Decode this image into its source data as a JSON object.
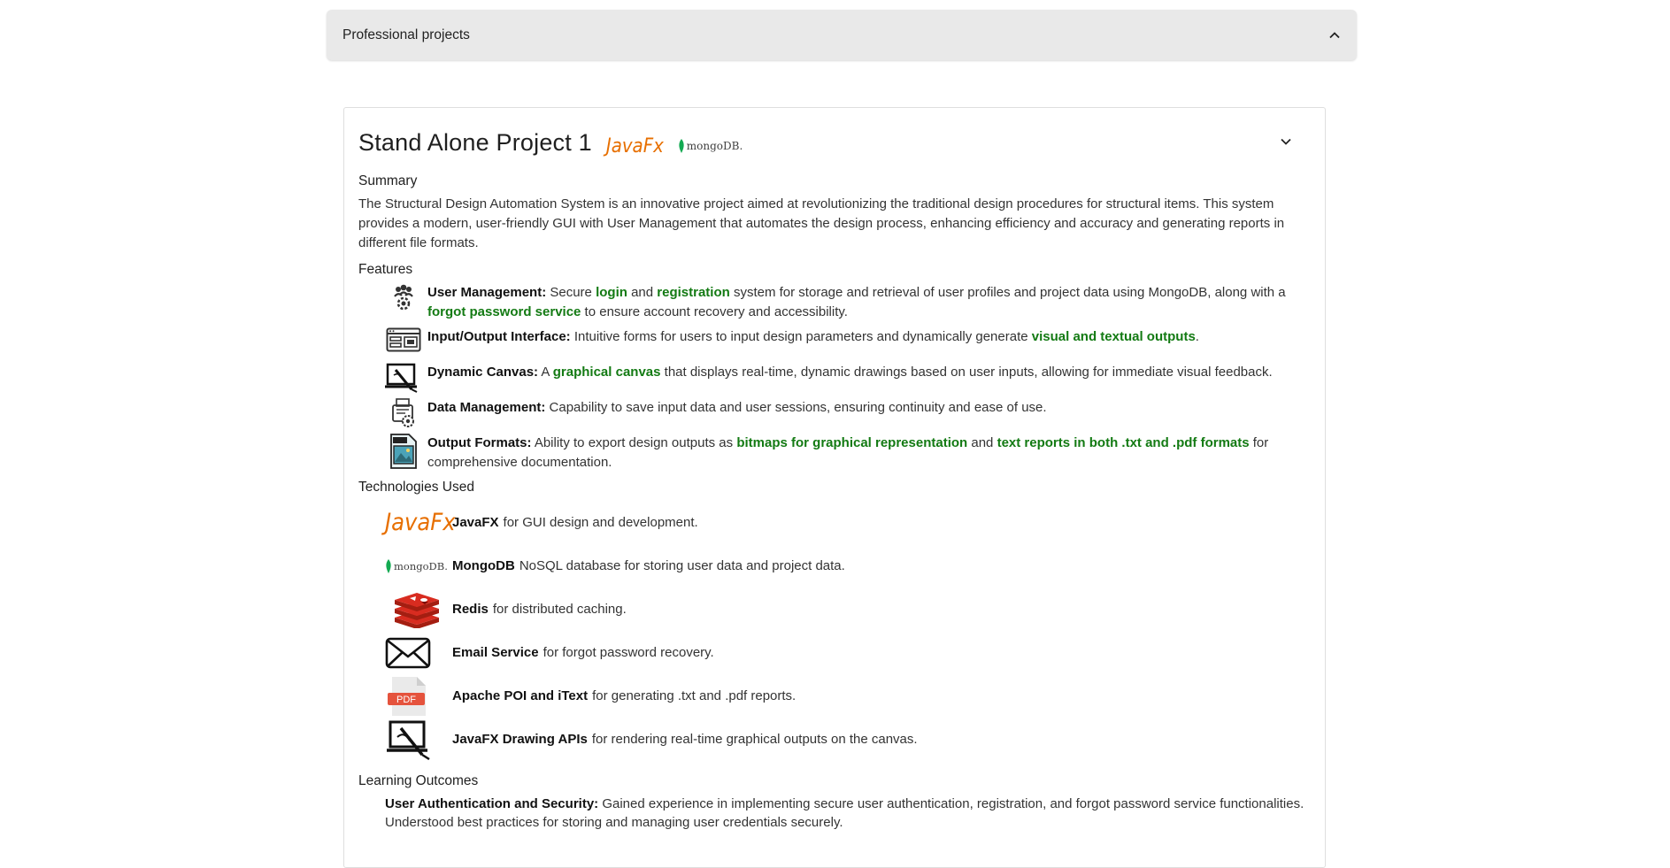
{
  "accordion": {
    "label": "Professional projects"
  },
  "project": {
    "title": "Stand Alone Project 1",
    "logos": {
      "javafx": "JavaFx",
      "mongodb": "mongoDB."
    },
    "summary_heading": "Summary",
    "summary_text": "The Structural Design Automation System is an innovative project aimed at revolutionizing the traditional design procedures for structural items. This system provides a modern, user-friendly GUI with User Management that automates the design process, enhancing efficiency and accuracy and generating reports in different file formats.",
    "features_heading": "Features",
    "features": [
      {
        "icon": "user-management-icon",
        "title": "User Management:",
        "t1": " Secure ",
        "h1": "login",
        "t2": " and ",
        "h2": "registration",
        "t3": " system for storage and retrieval of user profiles and project data using MongoDB, along with a ",
        "h3": "forgot password service",
        "t4": " to ensure account recovery and accessibility."
      },
      {
        "icon": "input-output-icon",
        "title": "Input/Output Interface:",
        "t1": " Intuitive forms for users to input design parameters and dynamically generate ",
        "h1": "visual and textual outputs",
        "t2": "."
      },
      {
        "icon": "drawing-canvas-icon",
        "title": "Dynamic Canvas:",
        "t1": " A ",
        "h1": "graphical canvas",
        "t2": " that displays real-time, dynamic drawings based on user inputs, allowing for immediate visual feedback."
      },
      {
        "icon": "data-management-icon",
        "title": "Data Management:",
        "t1": " Capability to save input data and user sessions, ensuring continuity and ease of use."
      },
      {
        "icon": "jpeg-file-icon",
        "title": "Output Formats:",
        "t1": " Ability to export design outputs as ",
        "h1": "bitmaps for graphical representation",
        "t2": " and ",
        "h2": "text reports in both .txt and .pdf formats",
        "t3": " for comprehensive documentation."
      }
    ],
    "tech_heading": "Technologies Used",
    "technologies": [
      {
        "icon": "javafx-logo",
        "logo_text": "JavaFx",
        "name": "JavaFX",
        "desc": "for GUI design and development."
      },
      {
        "icon": "mongodb-logo",
        "logo_text": "mongoDB.",
        "name": "MongoDB",
        "desc": "NoSQL database for storing user data and project data."
      },
      {
        "icon": "redis-logo",
        "name": "Redis",
        "desc": "for distributed caching."
      },
      {
        "icon": "envelope-icon",
        "name": "Email Service",
        "desc": "for forgot password recovery."
      },
      {
        "icon": "pdf-file-icon",
        "logo_text": "PDF",
        "name": "Apache POI and iText",
        "desc": "for generating .txt and .pdf reports."
      },
      {
        "icon": "drawing-canvas-icon",
        "name": "JavaFX Drawing APIs",
        "desc": "for rendering real-time graphical outputs on the canvas."
      }
    ],
    "outcomes_heading": "Learning Outcomes",
    "outcomes": [
      {
        "title": "User Authentication and Security:",
        "desc": " Gained experience in implementing secure user authentication, registration, and forgot password service functionalities. Understood best practices for storing and managing user credentials securely."
      }
    ]
  },
  "colors": {
    "highlight": "#137a13",
    "javafx_orange": "#e76f00",
    "javafx_blue": "#5382a1",
    "mongodb_green": "#13aa52",
    "redis_red": "#d82c20",
    "pdf_red": "#e5533d"
  }
}
